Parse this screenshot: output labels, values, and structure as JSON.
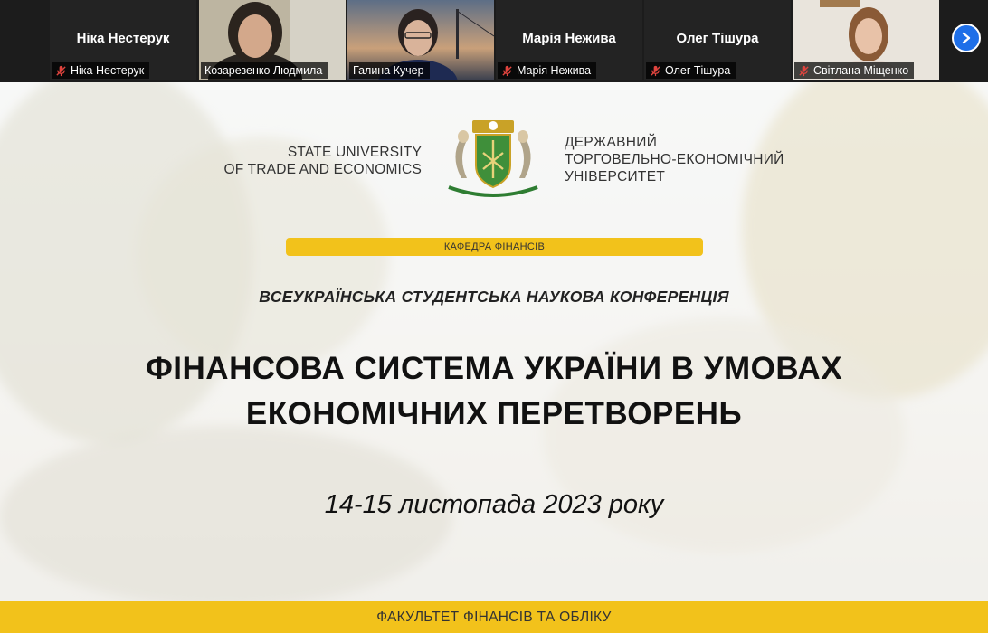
{
  "participants": [
    {
      "display_name": "Ніка Нестерук",
      "label": "Ніка Нестерук",
      "muted": true,
      "video": false
    },
    {
      "display_name": "",
      "label": "Козарезенко Людмила",
      "muted": false,
      "video": true
    },
    {
      "display_name": "",
      "label": "Галина Кучер",
      "muted": false,
      "video": true,
      "active": true
    },
    {
      "display_name": "Марія Нежива",
      "label": "Марія Нежива",
      "muted": true,
      "video": false
    },
    {
      "display_name": "Олег Тішура",
      "label": "Олег Тішура",
      "muted": true,
      "video": false
    },
    {
      "display_name": "",
      "label": "Світлана Міщенко",
      "muted": true,
      "video": true
    }
  ],
  "slide": {
    "university_en_line1": "STATE UNIVERSITY",
    "university_en_line2": "OF TRADE AND ECONOMICS",
    "university_ua_line1": "ДЕРЖАВНИЙ",
    "university_ua_line2": "ТОРГОВЕЛЬНО-ЕКОНОМІЧНИЙ",
    "university_ua_line3": "УНІВЕРСИТЕТ",
    "department": "КАФЕДРА ФІНАНСІВ",
    "conference": "ВСЕУКРАЇНСЬКА СТУДЕНТСЬКА НАУКОВА КОНФЕРЕНЦІЯ",
    "title_line1": "ФІНАНСОВА СИСТЕМА УКРАЇНИ В УМОВАХ",
    "title_line2": "ЕКОНОМІЧНИХ ПЕРЕТВОРЕНЬ",
    "dates": "14-15 листопада 2023 року",
    "faculty": "ФАКУЛЬТЕТ ФІНАНСІВ ТА ОБЛІКУ"
  },
  "colors": {
    "accent_yellow": "#f2c21b",
    "active_speaker": "#9acd32",
    "nav_button": "#1e6fe8",
    "muted_icon": "#e0443e"
  },
  "icons": {
    "next": "chevron-right-icon",
    "mic_off": "mic-off-icon",
    "crest": "university-crest-icon"
  }
}
